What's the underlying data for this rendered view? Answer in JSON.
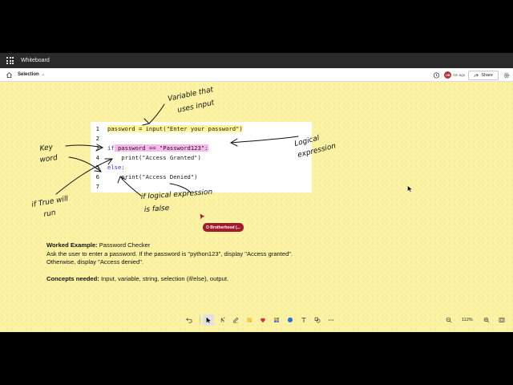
{
  "app": {
    "title": "Whiteboard"
  },
  "toolbar": {
    "mode": "Selection",
    "avatar_initials": "OB",
    "last_edit": "4m ago",
    "share_label": "Share"
  },
  "code": {
    "lines": [
      {
        "n": "1",
        "text": "password = input(\"Enter your password\")"
      },
      {
        "n": "2",
        "text": ""
      },
      {
        "n": "3",
        "kw": "if",
        "text": " password == \"Password123\":"
      },
      {
        "n": "4",
        "text": "    print(\"Access Granted\")"
      },
      {
        "n": "5",
        "kw": "else",
        "text": ":"
      },
      {
        "n": "6",
        "text": "    print(\"Access Denied\")"
      },
      {
        "n": "7",
        "text": ""
      }
    ]
  },
  "annotations": {
    "variable": [
      "Variable that",
      "uses input"
    ],
    "logical": [
      "Logical",
      "expression"
    ],
    "keyword": [
      "Key",
      "word"
    ],
    "iftrue": [
      "if True will",
      "run"
    ],
    "iflogical": [
      "if logical expression",
      "is false"
    ]
  },
  "collaborator": {
    "name": "O Brotherhood (..."
  },
  "worked": {
    "heading": "Worked Example:",
    "title": " Password Checker",
    "line1": "Ask the user to enter a password. If the password is \"python123\", display \"Access granted\".",
    "line2": "Otherwise, display \"Access denied\".",
    "concepts_heading": "Concepts needed:",
    "concepts": " Input, variable, string, selection (if/else), output."
  },
  "zoom": {
    "level": "112%"
  },
  "colors": {
    "board": "#fbf2a3",
    "tag": "#a11b2b",
    "highlight_yellow": "#fff69a",
    "highlight_pink": "#f7b8ec",
    "keyword": "#2c2cff"
  }
}
